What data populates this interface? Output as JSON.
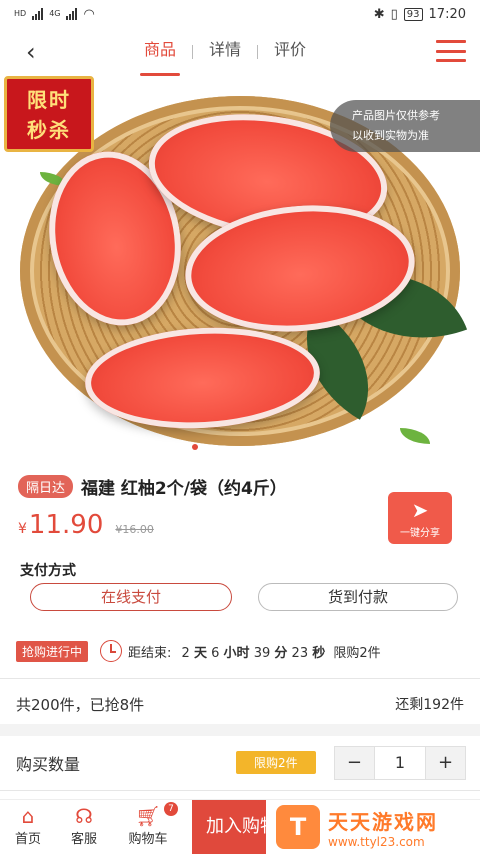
{
  "statusbar": {
    "time": "17:20",
    "battery": "93",
    "left_tags": [
      "HD",
      "4G",
      "HD",
      "4G"
    ]
  },
  "nav": {
    "back_icon": "chevron-left-icon",
    "tabs": [
      "商品",
      "详情",
      "评价"
    ],
    "active_tab": 0,
    "menu_icon": "hamburger-icon"
  },
  "hero": {
    "flash_sale_line1": "限时",
    "flash_sale_line2": "秒杀",
    "disclaimer_line1": "产品图片仅供参考",
    "disclaimer_line2": "以收到实物为准"
  },
  "product": {
    "badge": "隔日达",
    "title": "福建 红柚2个/袋（约4斤）",
    "currency": "¥",
    "price": "11.90",
    "old_price": "¥16.00",
    "share_label": "一键分享"
  },
  "payment": {
    "label": "支付方式",
    "options": [
      "在线支付",
      "货到付款"
    ],
    "selected": 0
  },
  "countdown": {
    "rush_label": "抢购进行中",
    "prefix": "距结束:",
    "days": "2",
    "days_unit": "天",
    "hours": "6",
    "hours_unit": "小时",
    "minutes": "39",
    "minutes_unit": "分",
    "seconds": "23",
    "seconds_unit": "秒",
    "limit_text": "限购2件"
  },
  "stock": {
    "sold_text": "共200件，已抢8件",
    "remaining_text": "还剩192件"
  },
  "quantity": {
    "label": "购买数量",
    "limit_badge": "限购2件",
    "minus": "−",
    "value": "1",
    "plus": "+"
  },
  "bottom": {
    "home": "首页",
    "service": "客服",
    "cart": "购物车",
    "cart_count": "7",
    "add_to_cart": "加入购物车"
  },
  "watermark": {
    "logo_text": "T",
    "name": "天天游戏网",
    "url": "www.ttyl23.com"
  },
  "colors": {
    "accent": "#e24a3b",
    "limit_badge": "#f3b52a",
    "watermark": "#ff7a2a"
  }
}
